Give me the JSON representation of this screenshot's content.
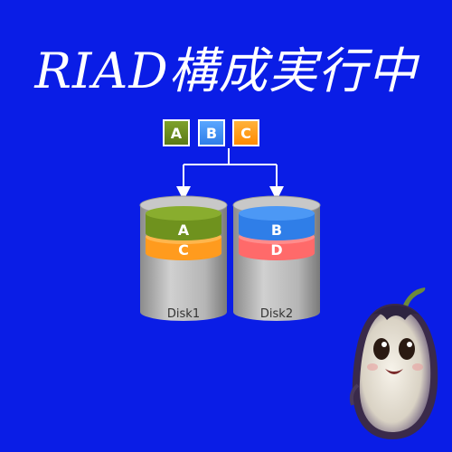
{
  "title": "RIAD構成実行中",
  "blocks": [
    "A",
    "B",
    "C"
  ],
  "disks": [
    {
      "label": "Disk1",
      "segments": [
        "A",
        "C"
      ]
    },
    {
      "label": "Disk2",
      "segments": [
        "B",
        "D"
      ]
    }
  ],
  "colors": {
    "background": "#0a1de6",
    "block_a": "#6b8f1f",
    "block_b": "#3b8df2",
    "block_c": "#ff9a10",
    "segment_a": "#6f921e",
    "segment_c": "#ffa52a",
    "segment_b": "#2f7ee8",
    "segment_d": "#ff6f6f",
    "disk_body": "#b8b8b8"
  },
  "mascot_icon": "eggplant-mascot-icon"
}
